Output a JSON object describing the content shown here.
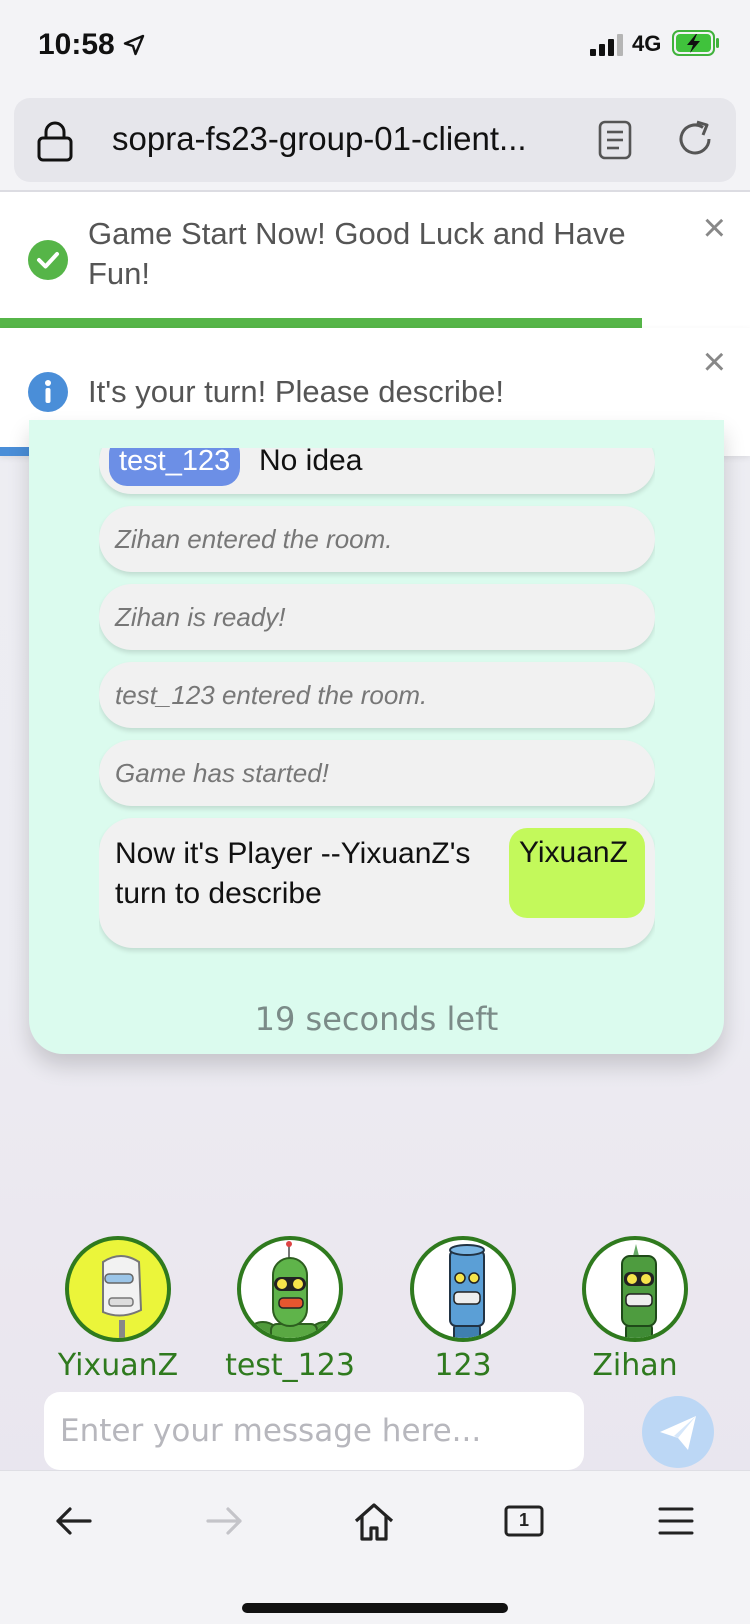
{
  "status_bar": {
    "time": "10:58",
    "network": "4G"
  },
  "browser": {
    "url": "sopra-fs23-group-01-client..."
  },
  "notifications": [
    {
      "type": "success",
      "text": "Game Start Now! Good Luck and Have Fun!",
      "progress": 0.86
    },
    {
      "type": "info",
      "text": "It's your turn! Please describe!",
      "progress": 0.86
    }
  ],
  "chat": {
    "messages": [
      {
        "kind": "user",
        "user": "test_123",
        "text": "No idea"
      },
      {
        "kind": "system",
        "text": "Zihan entered the room."
      },
      {
        "kind": "system",
        "text": "Zihan is ready!"
      },
      {
        "kind": "system",
        "text": "test_123 entered the room."
      },
      {
        "kind": "system",
        "text": "Game has started!"
      },
      {
        "kind": "turn",
        "text": "Now it's Player --YixuanZ's turn to describe",
        "badge": "YixuanZ"
      }
    ],
    "timer": "19 seconds left"
  },
  "players": [
    {
      "name": "YixuanZ",
      "active": true
    },
    {
      "name": "test_123",
      "active": false
    },
    {
      "name": "123",
      "active": false
    },
    {
      "name": "Zihan",
      "active": false
    }
  ],
  "input": {
    "placeholder": "Enter your message here..."
  },
  "toolbar": {
    "tab_count": "1"
  },
  "colors": {
    "success": "#56b548",
    "info": "#4a8ed8",
    "panel_bg": "#dbfbee",
    "player_border": "#2f7a1e",
    "turn_badge": "#c3f95b",
    "user_tag": "#6c8fe6"
  }
}
